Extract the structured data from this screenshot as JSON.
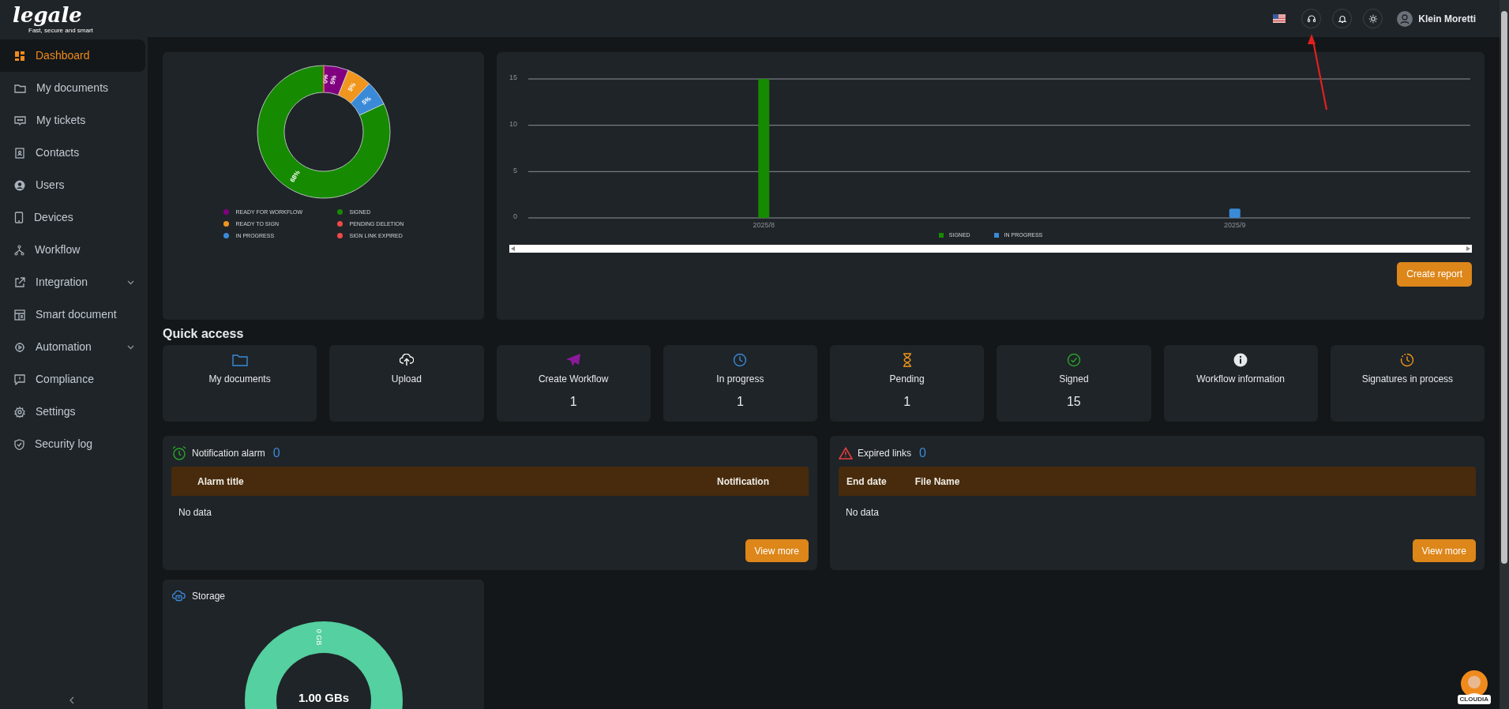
{
  "brand": {
    "name": "legale",
    "tagline": "Fast, secure and smart"
  },
  "sidebar": {
    "items": [
      {
        "label": "Dashboard",
        "selected": true,
        "expandable": false
      },
      {
        "label": "My documents",
        "selected": false,
        "expandable": false
      },
      {
        "label": "My tickets",
        "selected": false,
        "expandable": false
      },
      {
        "label": "Contacts",
        "selected": false,
        "expandable": false
      },
      {
        "label": "Users",
        "selected": false,
        "expandable": false
      },
      {
        "label": "Devices",
        "selected": false,
        "expandable": false
      },
      {
        "label": "Workflow",
        "selected": false,
        "expandable": false
      },
      {
        "label": "Integration",
        "selected": false,
        "expandable": true
      },
      {
        "label": "Smart document",
        "selected": false,
        "expandable": false
      },
      {
        "label": "Automation",
        "selected": false,
        "expandable": true
      },
      {
        "label": "Compliance",
        "selected": false,
        "expandable": false
      },
      {
        "label": "Settings",
        "selected": false,
        "expandable": false
      },
      {
        "label": "Security log",
        "selected": false,
        "expandable": false
      }
    ]
  },
  "top_bar": {
    "user_name": "Klein Moretti"
  },
  "status_chart": {
    "chart_data": {
      "type": "donut",
      "categories": [
        "READY FOR WORKFLOW",
        "READY TO SIGN",
        "IN PROGRESS",
        "SIGNED",
        "PENDING DELETION",
        "SIGN LINK EXPIRED"
      ],
      "values": [
        5,
        5,
        5,
        68,
        0,
        0
      ],
      "colors": [
        "#800080",
        "#f0961e",
        "#3a8ad8",
        "#168a00",
        "#f04848",
        "#f04848"
      ],
      "value_labels": [
        "5%",
        "5%",
        "5%",
        "68%",
        "0%",
        null
      ],
      "legend": "bottom"
    }
  },
  "monthly_chart": {
    "chart_data": {
      "type": "bar",
      "categories": [
        "2025/8",
        "2025/9"
      ],
      "series": [
        {
          "name": "SIGNED",
          "color": "#168a00",
          "values": [
            15,
            null
          ]
        },
        {
          "name": "IN PROGRESS",
          "color": "#3a8ad8",
          "values": [
            null,
            1
          ]
        }
      ],
      "ylim": [
        0,
        15
      ],
      "yticks": [
        0,
        5,
        10,
        15
      ],
      "legend": "bottom"
    },
    "button": "Create report"
  },
  "quick_access": {
    "title": "Quick access",
    "items": [
      {
        "label": "My documents"
      },
      {
        "label": "Upload"
      },
      {
        "label": "Create Workflow",
        "count": "1"
      },
      {
        "label": "In progress",
        "count": "1"
      },
      {
        "label": "Pending",
        "count": "1"
      },
      {
        "label": "Signed",
        "count": "15"
      },
      {
        "label": "Workflow information"
      },
      {
        "label": "Signatures in process"
      }
    ]
  },
  "panels": [
    {
      "title": "Notification alarm",
      "count": "0",
      "columns": [
        "Alarm title",
        "Notification"
      ],
      "empty_text": "No data",
      "button": "View more"
    },
    {
      "title": "Expired links",
      "count": "0",
      "columns": [
        "End date",
        "File Name"
      ],
      "empty_text": "No data",
      "button": "View more"
    }
  ],
  "storage": {
    "title": "Storage",
    "usage_label": "1.00 GBs",
    "used_label": "0 GB"
  },
  "assistant": {
    "name": "CLOUDIA"
  }
}
